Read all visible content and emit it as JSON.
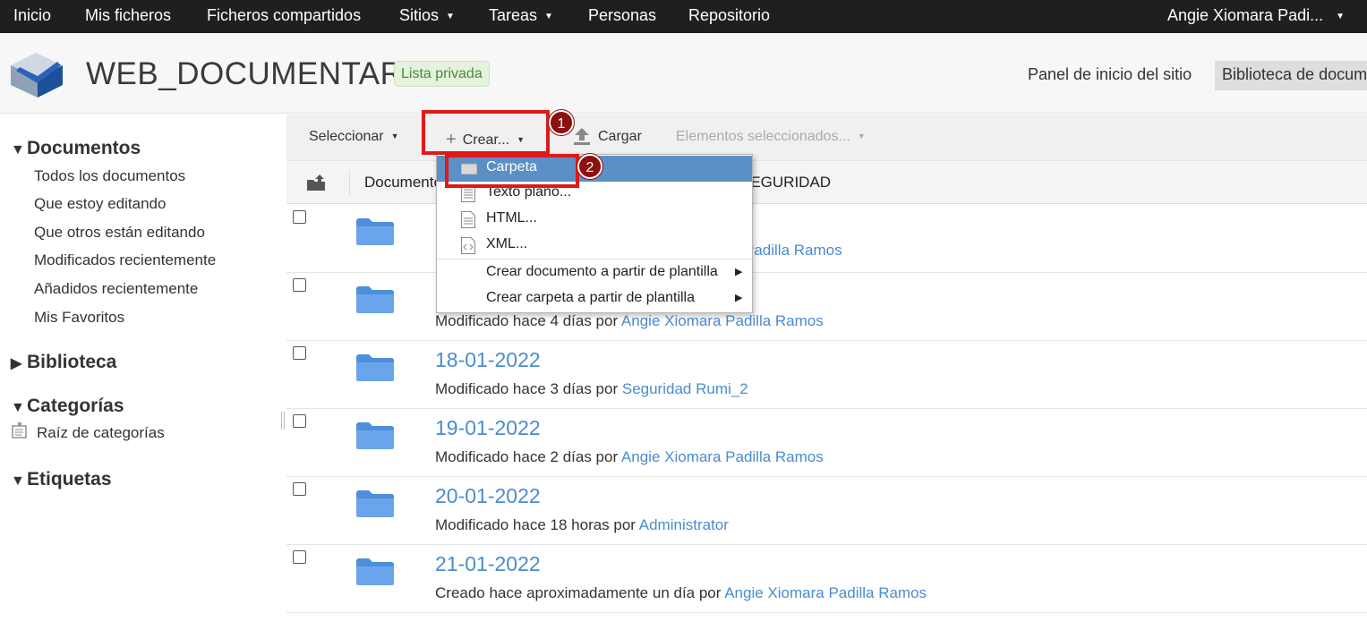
{
  "topnav": {
    "items": [
      {
        "label": "Inicio"
      },
      {
        "label": "Mis ficheros"
      },
      {
        "label": "Ficheros compartidos"
      },
      {
        "label": "Sitios"
      },
      {
        "label": "Tareas"
      },
      {
        "label": "Personas"
      },
      {
        "label": "Repositorio"
      }
    ],
    "user": "Angie Xiomara Padi..."
  },
  "header": {
    "site_title": "WEB_DOCUMENTARIA",
    "badge": "Lista privada",
    "dashboard_link": "Panel de inicio del sitio",
    "library_tab": "Biblioteca de documentos"
  },
  "sidebar": {
    "documents_title": "Documentos",
    "documents_items": [
      "Todos los documentos",
      "Que estoy editando",
      "Que otros están editando",
      "Modificados recientemente",
      "Añadidos recientemente",
      "Mis Favoritos"
    ],
    "library_title": "Biblioteca",
    "categories_title": "Categorías",
    "categories_root": "Raíz de categorías",
    "tags_title": "Etiquetas"
  },
  "toolbar": {
    "select": "Seleccionar",
    "create": "Crear...",
    "upload": "Cargar",
    "selected_items": "Elementos seleccionados..."
  },
  "columns": {
    "documents": "Documentos",
    "security": "SEGURIDAD"
  },
  "rows": [
    {
      "name": "",
      "meta_prefix": "",
      "user": "Padilla Ramos"
    },
    {
      "name": "",
      "meta_prefix": "Modificado hace 4 días por ",
      "user": "Angie Xiomara Padilla Ramos"
    },
    {
      "name": "18-01-2022",
      "meta_prefix": "Modificado hace 3 días por ",
      "user": "Seguridad Rumi_2"
    },
    {
      "name": "19-01-2022",
      "meta_prefix": "Modificado hace 2 días por ",
      "user": "Angie Xiomara Padilla Ramos"
    },
    {
      "name": "20-01-2022",
      "meta_prefix": "Modificado hace 18 horas por ",
      "user": "Administrator"
    },
    {
      "name": "21-01-2022",
      "meta_prefix": "Creado hace aproximadamente un día por ",
      "user": "Angie Xiomara Padilla Ramos"
    }
  ],
  "create_menu": {
    "folder": "Carpeta",
    "plain_text": "Texto plano...",
    "html": "HTML...",
    "xml": "XML...",
    "from_doc_template": "Crear documento a partir de plantilla",
    "from_folder_template": "Crear carpeta a partir de plantilla"
  },
  "callouts": [
    "1",
    "2"
  ],
  "colors": {
    "topbar": "#1f1f1f",
    "link": "#4a8ccf",
    "menu_active": "#5b90c7",
    "highlight": "#e01818",
    "callout": "#8e0f0f"
  }
}
